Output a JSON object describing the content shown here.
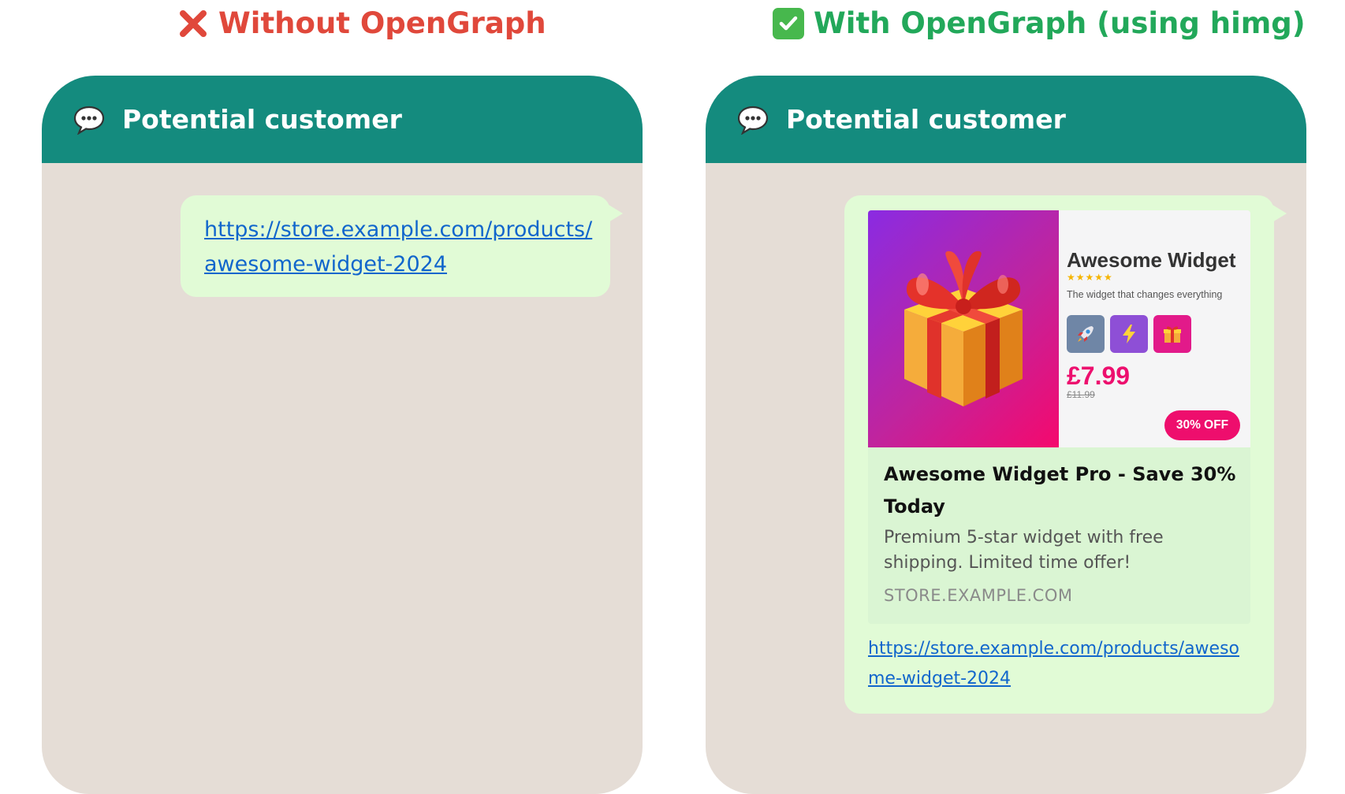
{
  "comparison": {
    "without": {
      "title": "Without OpenGraph",
      "icon": "cross-mark-icon",
      "color": "#e0483b"
    },
    "with": {
      "title": "With OpenGraph (using himg)",
      "icon": "check-mark-icon",
      "color": "#22a85a"
    }
  },
  "chat_left": {
    "header_title": "Potential customer",
    "header_icon": "speech-bubble-icon",
    "header_color": "#148b7e",
    "message_link": "https://store.example.com/products/awesome-widget-2024"
  },
  "chat_right": {
    "header_title": "Potential customer",
    "header_icon": "speech-bubble-icon",
    "message_link": "https://store.example.com/products/awesome-widget-2024",
    "preview": {
      "image": {
        "product_name": "Awesome Widget",
        "stars": "★★★★★",
        "tagline": "The widget that changes everything",
        "badges": [
          "rocket-icon",
          "lightning-icon",
          "gift-icon"
        ],
        "price": "£7.99",
        "old_price": "£11.99",
        "discount": "30% OFF",
        "main_icon": "gift-box-icon"
      },
      "title": "Awesome Widget Pro - Save 30% Today",
      "description": "Premium 5-star widget with free shipping. Limited time offer!",
      "domain": "STORE.EXAMPLE.COM"
    }
  },
  "colors": {
    "bubble": "#e1fbd6",
    "chat_background": "#e5ddd6",
    "link": "#1166cc",
    "accent_pink": "#ee0e6d"
  }
}
